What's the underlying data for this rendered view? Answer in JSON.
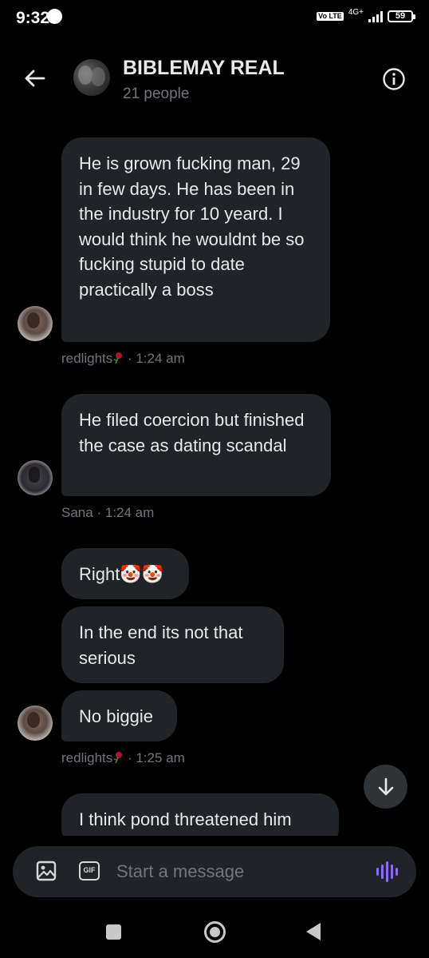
{
  "status_bar": {
    "time": "9:32",
    "volte": "Vo LTE",
    "network": "4G+",
    "battery": "59"
  },
  "header": {
    "title": "BIBLEMAY REAL",
    "subtitle": "21 people"
  },
  "messages": [
    {
      "text": "He is grown fucking man, 29 in few days. He has been in the industry for 10 yeard. I would think he wouldnt be so fucking stupid to date practically a boss"
    },
    {
      "text": "He filed coercion but finished the case as dating scandal"
    },
    {
      "text": "Right🤡🤡"
    },
    {
      "text": "In the end its not that serious"
    },
    {
      "text": "No biggie"
    },
    {
      "text": "I think pond threatened him"
    }
  ],
  "meta": [
    {
      "sender": "redlights",
      "time": "· 1:24 am"
    },
    {
      "sender": "Sana",
      "time": "· 1:24 am"
    },
    {
      "sender": "redlights",
      "time": "· 1:25 am"
    }
  ],
  "composer": {
    "placeholder": "Start a message",
    "gif_label": "GIF"
  },
  "icons": {
    "back": "arrow-left-icon",
    "info": "info-icon",
    "scroll_down": "arrow-down-icon",
    "image": "image-icon",
    "gif": "gif-icon",
    "voice": "voice-waveform-icon",
    "rose": "rose-emoji-icon"
  },
  "colors": {
    "background": "#000000",
    "bubble": "#202327",
    "text": "#e7e9ea",
    "muted": "#71767b",
    "voice_accent": "#8b6cf0"
  }
}
